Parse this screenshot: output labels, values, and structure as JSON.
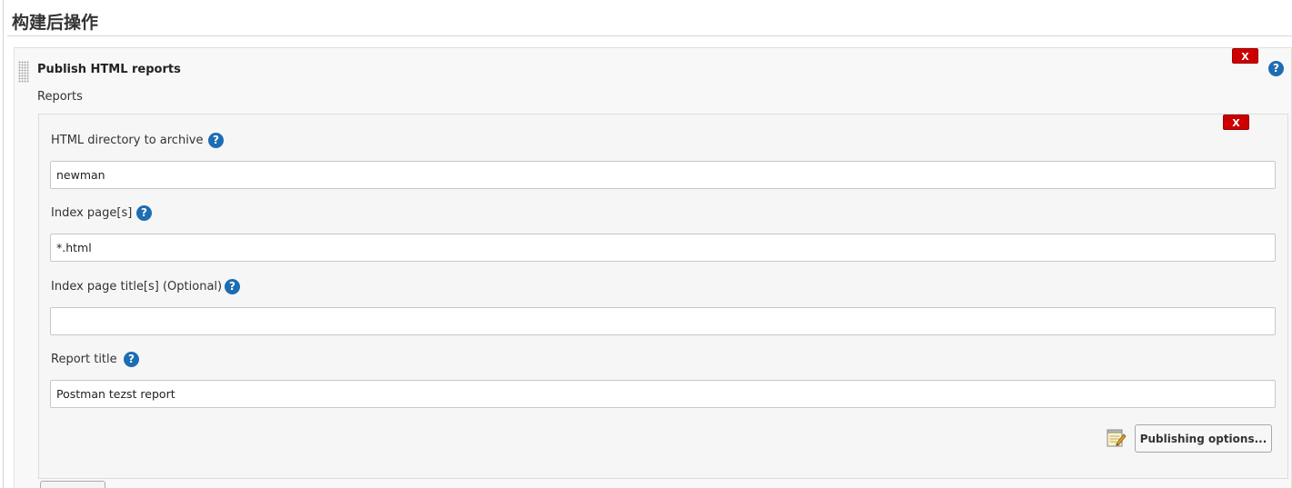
{
  "section": {
    "title": "构建后操作"
  },
  "step": {
    "title": "Publish HTML reports",
    "delete_label": "X",
    "help_glyph": "?"
  },
  "reports": {
    "label": "Reports",
    "delete_label": "X",
    "fields": [
      {
        "label": "HTML directory to archive",
        "value": "newman",
        "help_glyph": "?"
      },
      {
        "label": "Index page[s]",
        "value": "*.html",
        "help_glyph": "?"
      },
      {
        "label": "Index page title[s] (Optional)",
        "value": "",
        "help_glyph": "?"
      },
      {
        "label": "Report title",
        "value": "Postman tezst report",
        "help_glyph": "?"
      }
    ],
    "publishing_options_label": "Publishing options..."
  },
  "colors": {
    "delete_red": "#cc0000",
    "help_blue": "#1d6db3",
    "panel_bg": "#f8f8f8"
  },
  "icons": {
    "drag": "drag-handle-icon",
    "help": "help-icon",
    "notepad": "notepad-icon"
  }
}
